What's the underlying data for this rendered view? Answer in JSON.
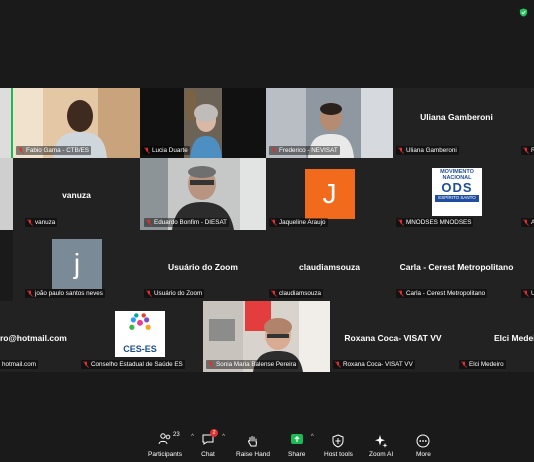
{
  "colors": {
    "background": "#1a1a1a",
    "tile": "#222222",
    "mute_red": "#e02f2f",
    "share_green": "#1db954"
  },
  "participants": [
    {
      "name": "Fabio Gama - CTB/ES",
      "type": "video"
    },
    {
      "name": "Lucia Duarte",
      "type": "video"
    },
    {
      "name": "Frederico - NEVISAT",
      "type": "video"
    },
    {
      "name": "Uliana Gamberoni",
      "display": "Uliana Gamberoni",
      "type": "name"
    },
    {
      "name": "R",
      "type": "partial"
    },
    {
      "name": "vanuza",
      "display": "vanuza",
      "type": "name"
    },
    {
      "name": "Eduardo Bonfim - DIESAT",
      "type": "video"
    },
    {
      "name": "Jaqueline Araujo",
      "initial": "J",
      "type": "avatar"
    },
    {
      "name": "MNODSES MNODSES",
      "type": "logo-ods"
    },
    {
      "name": "A",
      "type": "partial"
    },
    {
      "name": "joão paulo santos neves",
      "initial": "j",
      "type": "avatar"
    },
    {
      "name": "Usuário do Zoom",
      "display": "Usuário do Zoom",
      "type": "name"
    },
    {
      "name": "claudiamsouza",
      "display": "claudiamsouza",
      "type": "name"
    },
    {
      "name": "Carla - Cerest Metropolitano",
      "display": "Carla - Cerest Metropolitano",
      "type": "name"
    },
    {
      "name": "U",
      "type": "partial"
    },
    {
      "name": "hotmail.com",
      "display": "ro@hotmail.com",
      "type": "name"
    },
    {
      "name": "Conselho Estadual de Saúde ES",
      "type": "logo-ces"
    },
    {
      "name": "Sonia Maria Balense Pereira",
      "type": "video"
    },
    {
      "name": "Roxana Coca- VISAT VV",
      "display": "Roxana Coca- VISAT VV",
      "type": "name"
    },
    {
      "name": "Elci Medeiro",
      "display": "Elci Medeiro",
      "type": "name"
    }
  ],
  "ods_logo": {
    "line1": "MOVIMENTO",
    "line2": "NACIONAL",
    "line3": "ODS",
    "line4": "ESPÍRITO SANTO"
  },
  "ces_logo": {
    "text": "CES-ES"
  },
  "toolbar": {
    "participants": {
      "label": "Participants",
      "count": "23"
    },
    "chat": {
      "label": "Chat",
      "badge": "2"
    },
    "raise_hand": {
      "label": "Raise Hand"
    },
    "share": {
      "label": "Share"
    },
    "host_tools": {
      "label": "Host tools"
    },
    "zoom_ai": {
      "label": "Zoom AI"
    },
    "more": {
      "label": "More"
    }
  }
}
